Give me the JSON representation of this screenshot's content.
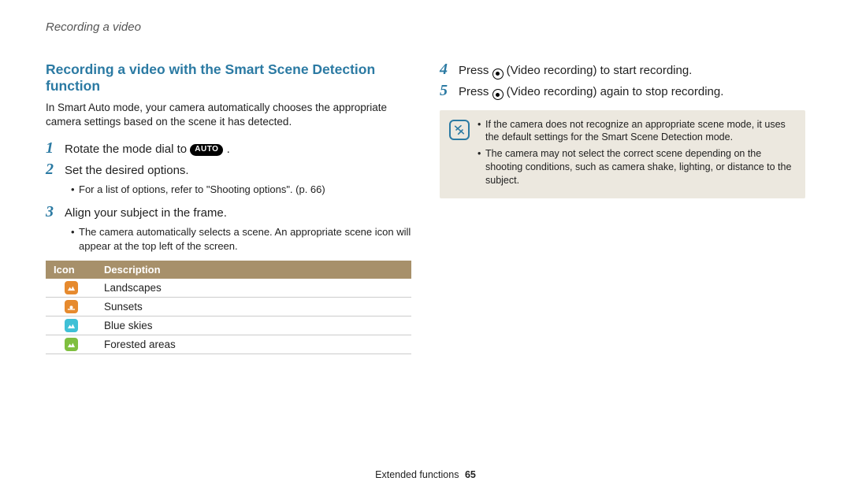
{
  "header": {
    "breadcrumb": "Recording a video"
  },
  "section": {
    "title": "Recording a video with the Smart Scene Detection function",
    "intro": "In Smart Auto mode, your camera automatically chooses the appropriate camera settings based on the scene it has detected."
  },
  "steps": [
    {
      "num": "1",
      "text_before": "Rotate the mode dial to ",
      "badge": "AUTO",
      "text_after": " ."
    },
    {
      "num": "2",
      "text": "Set the desired options.",
      "sub": [
        "For a list of options, refer to \"Shooting options\". (p. 66)"
      ]
    },
    {
      "num": "3",
      "text": "Align your subject in the frame.",
      "sub": [
        "The camera automatically selects a scene. An appropriate scene icon will appear at the top left of the screen."
      ]
    },
    {
      "num": "4",
      "text_before": "Press ",
      "text_after": " (Video recording) to start recording."
    },
    {
      "num": "5",
      "text_before": "Press ",
      "text_after": " (Video recording) again to stop recording."
    }
  ],
  "table": {
    "headers": [
      "Icon",
      "Description"
    ],
    "rows": [
      {
        "icon": "landscape-icon",
        "color": "orange",
        "label": "Landscapes"
      },
      {
        "icon": "sunset-icon",
        "color": "orange",
        "label": "Sunsets"
      },
      {
        "icon": "bluesky-icon",
        "color": "cyan",
        "label": "Blue skies"
      },
      {
        "icon": "forest-icon",
        "color": "green",
        "label": "Forested areas"
      }
    ]
  },
  "note": {
    "items": [
      "If the camera does not recognize an appropriate scene mode, it uses the default settings for the Smart Scene Detection mode.",
      "The camera may not select the correct scene depending on the shooting conditions, such as camera shake, lighting, or distance to the subject."
    ]
  },
  "footer": {
    "section": "Extended functions",
    "page": "65"
  }
}
